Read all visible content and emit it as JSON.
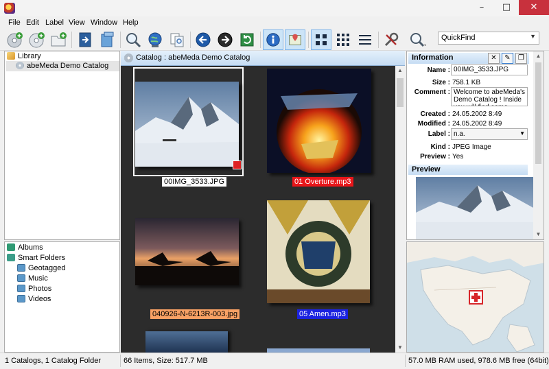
{
  "window": {
    "minimize_glyph": "–",
    "maximize_glyph": "□",
    "close_glyph": "✕"
  },
  "menu": [
    "File",
    "Edit",
    "Label",
    "View",
    "Window",
    "Help"
  ],
  "toolbar": {
    "buttons": [
      "add-catalog-icon",
      "add-disc-icon",
      "add-folder-icon",
      "import-icon",
      "export-icon",
      "search-icon",
      "globe-icon",
      "duplicates-icon",
      "back-icon",
      "forward-icon",
      "refresh-icon",
      "info-icon",
      "map-pane-icon",
      "grid-view-icon",
      "small-grid-view-icon",
      "list-view-icon",
      "settings-icon",
      "quickfind-icon"
    ],
    "quickfind": "QuickFind"
  },
  "library": {
    "title": "Library",
    "items": [
      "abeMeda Demo Catalog"
    ]
  },
  "albums": {
    "title": "Albums",
    "smart_folders": "Smart Folders",
    "folders": [
      "Geotagged",
      "Music",
      "Photos",
      "Videos"
    ]
  },
  "catalog": {
    "header": "Catalog : abeMeda Demo Catalog",
    "items": [
      {
        "caption": "00IMG_3533.JPG",
        "label_color": "#ffffff",
        "selected": true
      },
      {
        "caption": "01 Overture.mp3",
        "label_color": "#e8161a"
      },
      {
        "caption": "040926-N-6213R-003.jpg",
        "label_color": "#f8a164"
      },
      {
        "caption": "05 Amen.mp3",
        "label_color": "#1b22e0"
      }
    ]
  },
  "info": {
    "title": "Information",
    "name_label": "Name :",
    "name_value": "00IMG_3533.JPG",
    "size_label": "Size :",
    "size_value": "758.1 KB",
    "comment_label": "Comment :",
    "comment_value": "Welcome to abeMeda's Demo Catalog ! Inside you will find some sample",
    "created_label": "Created :",
    "created_value": "24.05.2002 8:49",
    "modified_label": "Modified :",
    "modified_value": "24.05.2002 8:49",
    "label_label": "Label :",
    "label_value": "n.a.",
    "kind_label": "Kind :",
    "kind_value": "JPEG Image",
    "preview_label": "Preview :",
    "preview_value": "Yes",
    "preview_section": "Preview"
  },
  "status": {
    "left": "1 Catalogs, 1 Catalog Folder",
    "middle": "66 Items, Size: 517.7 MB",
    "right": "57.0 MB RAM used, 978.6 MB free (64bit)"
  }
}
